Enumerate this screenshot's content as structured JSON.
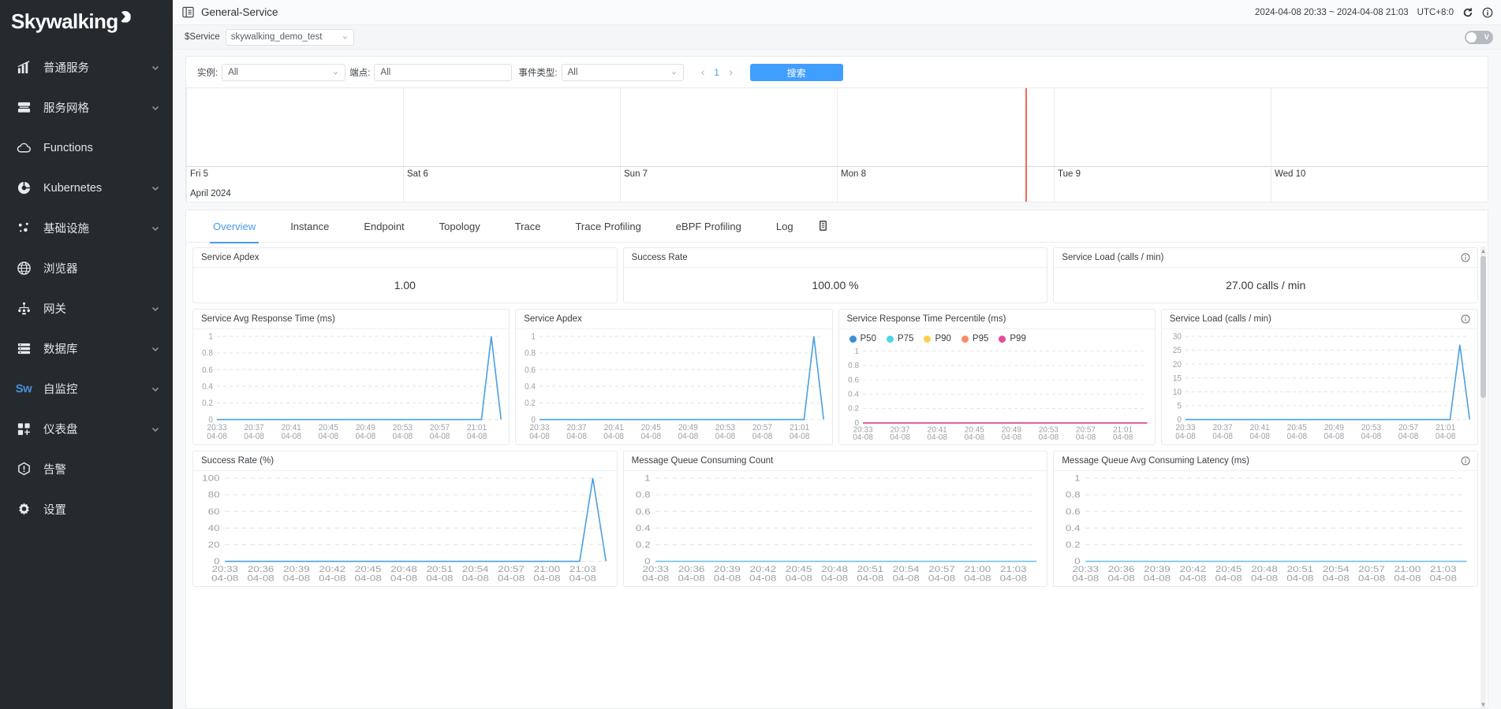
{
  "sidebar": {
    "logo": "Skywalking",
    "items": [
      {
        "label": "普通服务",
        "icon": "chart-bar-icon",
        "expandable": true
      },
      {
        "label": "服务网格",
        "icon": "layers-icon",
        "expandable": true
      },
      {
        "label": "Functions",
        "icon": "cloud-icon",
        "expandable": false
      },
      {
        "label": "Kubernetes",
        "icon": "kubernetes-icon",
        "expandable": true
      },
      {
        "label": "基础设施",
        "icon": "nodes-icon",
        "expandable": true
      },
      {
        "label": "浏览器",
        "icon": "globe-icon",
        "expandable": false
      },
      {
        "label": "网关",
        "icon": "gateway-icon",
        "expandable": true
      },
      {
        "label": "数据库",
        "icon": "database-icon",
        "expandable": true
      },
      {
        "label": "自监控",
        "icon": "skywalking-sw-icon",
        "expandable": true
      },
      {
        "label": "仪表盘",
        "icon": "dashboard-grid-icon",
        "expandable": true
      },
      {
        "label": "告警",
        "icon": "alarm-icon",
        "expandable": false
      },
      {
        "label": "设置",
        "icon": "gear-icon",
        "expandable": false
      }
    ]
  },
  "topbar": {
    "title": "General-Service",
    "time_range": "2024-04-08 20:33 ~ 2024-04-08 21:03",
    "timezone": "UTC+8:0",
    "reload_icon": "refresh-icon",
    "info_icon": "info-circle-icon",
    "collapse_icon": "collapse-sidebar-icon"
  },
  "service_bar": {
    "label": "$Service",
    "selected": "skywalking_demo_test",
    "toggle_label": "V"
  },
  "filters": {
    "instance": {
      "label": "实例:",
      "value": "All"
    },
    "endpoint": {
      "label": "端点:",
      "value": "All"
    },
    "event_type": {
      "label": "事件类型:",
      "value": "All"
    },
    "page": "1",
    "search_button": "搜索"
  },
  "timeline": {
    "ticks": [
      "Fri 5",
      "Sat 6",
      "Sun 7",
      "Mon 8",
      "Tue 9",
      "Wed 10"
    ],
    "month": "April 2024",
    "marker_color": "#ef6a51",
    "marker_position_pct": 64.5
  },
  "tabs": {
    "items": [
      {
        "label": "Overview",
        "active": true
      },
      {
        "label": "Instance",
        "active": false
      },
      {
        "label": "Endpoint",
        "active": false
      },
      {
        "label": "Topology",
        "active": false
      },
      {
        "label": "Trace",
        "active": false
      },
      {
        "label": "Trace Profiling",
        "active": false
      },
      {
        "label": "eBPF Profiling",
        "active": false
      },
      {
        "label": "Log",
        "active": false
      }
    ],
    "copy_icon": "copy-icon",
    "active_color": "#4a9bf0"
  },
  "metric_cards": [
    {
      "title": "Service Apdex",
      "value": "1.00",
      "has_info": false
    },
    {
      "title": "Success Rate",
      "value": "100.00 %",
      "has_info": false
    },
    {
      "title": "Service Load (calls / min)",
      "value": "27.00 calls / min",
      "has_info": true
    }
  ],
  "chart_data": [
    {
      "id": "service-avg-response-time",
      "type": "line",
      "title": "Service Avg Response Time (ms)",
      "has_info": false,
      "xlabel": "",
      "ylabel": "",
      "yticks": [
        "1",
        "0.8",
        "0.6",
        "0.4",
        "0.2",
        "0"
      ],
      "ylim": [
        0,
        1
      ],
      "xticks": [
        "20:33\n04-08",
        "20:37\n04-08",
        "20:41\n04-08",
        "20:45\n04-08",
        "20:49\n04-08",
        "20:53\n04-08",
        "20:57\n04-08",
        "21:01\n04-08"
      ],
      "series": [
        {
          "name": "Service Avg Response Time",
          "color": "#4b9fe0",
          "values": [
            0,
            0,
            0,
            0,
            0,
            0,
            0,
            0,
            0,
            0,
            0,
            0,
            0,
            0,
            0,
            0,
            0,
            0,
            0,
            0,
            0,
            0,
            0,
            0,
            0,
            0,
            0,
            0,
            1,
            0
          ]
        }
      ],
      "grid": true,
      "legend": false
    },
    {
      "id": "service-apdex-chart",
      "type": "line",
      "title": "Service Apdex",
      "has_info": false,
      "xlabel": "",
      "ylabel": "",
      "yticks": [
        "1",
        "0.8",
        "0.6",
        "0.4",
        "0.2",
        "0"
      ],
      "ylim": [
        0,
        1
      ],
      "xticks": [
        "20:33\n04-08",
        "20:37\n04-08",
        "20:41\n04-08",
        "20:45\n04-08",
        "20:49\n04-08",
        "20:53\n04-08",
        "20:57\n04-08",
        "21:01\n04-08"
      ],
      "series": [
        {
          "name": "Service Apdex",
          "color": "#4b9fe0",
          "values": [
            0,
            0,
            0,
            0,
            0,
            0,
            0,
            0,
            0,
            0,
            0,
            0,
            0,
            0,
            0,
            0,
            0,
            0,
            0,
            0,
            0,
            0,
            0,
            0,
            0,
            0,
            0,
            0,
            1,
            0
          ]
        }
      ],
      "grid": true,
      "legend": false
    },
    {
      "id": "service-response-time-percentile",
      "type": "line",
      "title": "Service Response Time Percentile (ms)",
      "has_info": false,
      "xlabel": "",
      "ylabel": "",
      "yticks": [
        "1",
        "0.8",
        "0.6",
        "0.4",
        "0.2",
        "0"
      ],
      "ylim": [
        0,
        1
      ],
      "xticks": [
        "20:33\n04-08",
        "20:37\n04-08",
        "20:41\n04-08",
        "20:45\n04-08",
        "20:49\n04-08",
        "20:53\n04-08",
        "20:57\n04-08",
        "21:01\n04-08"
      ],
      "legend": true,
      "legend_position": "top-left",
      "series": [
        {
          "name": "P50",
          "color": "#3a8fd4",
          "values": [
            0,
            0,
            0,
            0,
            0,
            0,
            0,
            0,
            0,
            0,
            0,
            0,
            0,
            0,
            0,
            0,
            0,
            0,
            0,
            0,
            0,
            0,
            0,
            0,
            0,
            0,
            0,
            0,
            0,
            0
          ]
        },
        {
          "name": "P75",
          "color": "#4fd6dd",
          "values": [
            0,
            0,
            0,
            0,
            0,
            0,
            0,
            0,
            0,
            0,
            0,
            0,
            0,
            0,
            0,
            0,
            0,
            0,
            0,
            0,
            0,
            0,
            0,
            0,
            0,
            0,
            0,
            0,
            0,
            0
          ]
        },
        {
          "name": "P90",
          "color": "#fbd04c",
          "values": [
            0,
            0,
            0,
            0,
            0,
            0,
            0,
            0,
            0,
            0,
            0,
            0,
            0,
            0,
            0,
            0,
            0,
            0,
            0,
            0,
            0,
            0,
            0,
            0,
            0,
            0,
            0,
            0,
            0,
            0
          ]
        },
        {
          "name": "P95",
          "color": "#fa8a64",
          "values": [
            0,
            0,
            0,
            0,
            0,
            0,
            0,
            0,
            0,
            0,
            0,
            0,
            0,
            0,
            0,
            0,
            0,
            0,
            0,
            0,
            0,
            0,
            0,
            0,
            0,
            0,
            0,
            0,
            0,
            0
          ]
        },
        {
          "name": "P99",
          "color": "#e14d9a",
          "values": [
            0,
            0,
            0,
            0,
            0,
            0,
            0,
            0,
            0,
            0,
            0,
            0,
            0,
            0,
            0,
            0,
            0,
            0,
            0,
            0,
            0,
            0,
            0,
            0,
            0,
            0,
            0,
            0,
            0,
            0
          ]
        }
      ],
      "grid": true
    },
    {
      "id": "service-load-chart",
      "type": "line",
      "title": "Service Load (calls / min)",
      "has_info": true,
      "xlabel": "",
      "ylabel": "",
      "yticks": [
        "30",
        "25",
        "20",
        "15",
        "10",
        "5",
        "0"
      ],
      "ylim": [
        0,
        30
      ],
      "xticks": [
        "20:33\n04-08",
        "20:37\n04-08",
        "20:41\n04-08",
        "20:45\n04-08",
        "20:49\n04-08",
        "20:53\n04-08",
        "20:57\n04-08",
        "21:01\n04-08"
      ],
      "series": [
        {
          "name": "Service Load",
          "color": "#4b9fe0",
          "values": [
            0,
            0,
            0,
            0,
            0,
            0,
            0,
            0,
            0,
            0,
            0,
            0,
            0,
            0,
            0,
            0,
            0,
            0,
            0,
            0,
            0,
            0,
            0,
            0,
            0,
            0,
            0,
            0,
            27,
            0
          ]
        }
      ],
      "grid": true,
      "legend": false
    },
    {
      "id": "success-rate-chart",
      "type": "line",
      "title": "Success Rate (%)",
      "has_info": false,
      "xlabel": "",
      "ylabel": "",
      "yticks": [
        "100",
        "80",
        "60",
        "40",
        "20",
        "0"
      ],
      "ylim": [
        0,
        100
      ],
      "xticks": [
        "20:33\n04-08",
        "20:36\n04-08",
        "20:39\n04-08",
        "20:42\n04-08",
        "20:45\n04-08",
        "20:48\n04-08",
        "20:51\n04-08",
        "20:54\n04-08",
        "20:57\n04-08",
        "21:00\n04-08",
        "21:03\n04-08"
      ],
      "series": [
        {
          "name": "Success Rate",
          "color": "#4b9fe0",
          "values": [
            0,
            0,
            0,
            0,
            0,
            0,
            0,
            0,
            0,
            0,
            0,
            0,
            0,
            0,
            0,
            0,
            0,
            0,
            0,
            0,
            0,
            0,
            0,
            0,
            0,
            0,
            0,
            0,
            100,
            0
          ]
        }
      ],
      "grid": true,
      "legend": false
    },
    {
      "id": "message-queue-consuming-count",
      "type": "line",
      "title": "Message Queue Consuming Count",
      "has_info": false,
      "xlabel": "",
      "ylabel": "",
      "yticks": [
        "1",
        "0.8",
        "0.6",
        "0.4",
        "0.2",
        "0"
      ],
      "ylim": [
        0,
        1
      ],
      "xticks": [
        "20:33\n04-08",
        "20:36\n04-08",
        "20:39\n04-08",
        "20:42\n04-08",
        "20:45\n04-08",
        "20:48\n04-08",
        "20:51\n04-08",
        "20:54\n04-08",
        "20:57\n04-08",
        "21:00\n04-08",
        "21:03\n04-08"
      ],
      "series": [
        {
          "name": "Message Queue Consuming Count",
          "color": "#6ec2ee",
          "values": [
            0,
            0,
            0,
            0,
            0,
            0,
            0,
            0,
            0,
            0,
            0,
            0,
            0,
            0,
            0,
            0,
            0,
            0,
            0,
            0,
            0,
            0,
            0,
            0,
            0,
            0,
            0,
            0,
            0,
            0
          ]
        }
      ],
      "grid": true,
      "legend": false
    },
    {
      "id": "message-queue-avg-consuming-latency",
      "type": "line",
      "title": "Message Queue Avg Consuming Latency (ms)",
      "has_info": true,
      "xlabel": "",
      "ylabel": "",
      "yticks": [
        "1",
        "0.8",
        "0.6",
        "0.4",
        "0.2",
        "0"
      ],
      "ylim": [
        0,
        1
      ],
      "xticks": [
        "20:33\n04-08",
        "20:36\n04-08",
        "20:39\n04-08",
        "20:42\n04-08",
        "20:45\n04-08",
        "20:48\n04-08",
        "20:51\n04-08",
        "20:54\n04-08",
        "20:57\n04-08",
        "21:00\n04-08",
        "21:03\n04-08"
      ],
      "series": [
        {
          "name": "Message Queue Avg Consuming Latency",
          "color": "#6ec2ee",
          "values": [
            0,
            0,
            0,
            0,
            0,
            0,
            0,
            0,
            0,
            0,
            0,
            0,
            0,
            0,
            0,
            0,
            0,
            0,
            0,
            0,
            0,
            0,
            0,
            0,
            0,
            0,
            0,
            0,
            0,
            0
          ]
        }
      ],
      "grid": true,
      "legend": false
    }
  ],
  "colors": {
    "accent": "#4a9bf0",
    "sidebar_bg": "#252a2f",
    "line": "#4b9fe0",
    "marker": "#ef6a51"
  }
}
